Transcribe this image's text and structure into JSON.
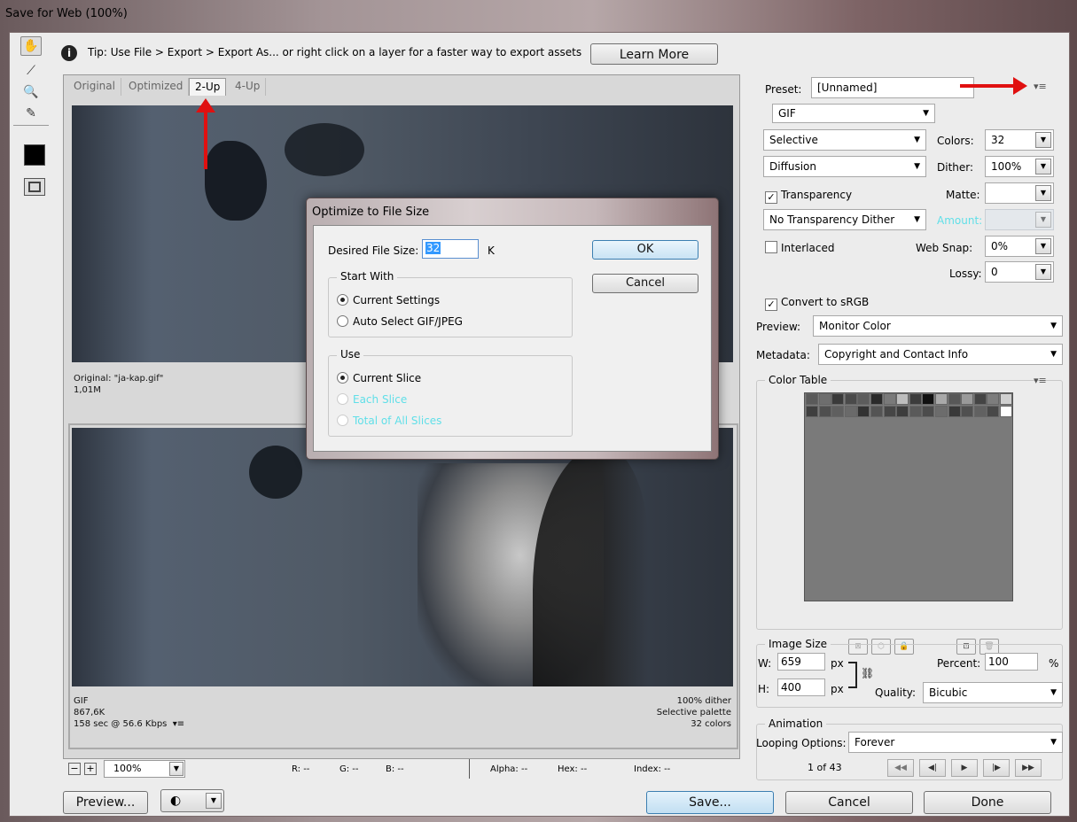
{
  "window": {
    "title": "Save for Web (100%)"
  },
  "tip": {
    "text": "Tip: Use File > Export > Export As...  or right click on a layer for a faster way to export assets",
    "learn_more": "Learn More"
  },
  "tabs": [
    "Original",
    "Optimized",
    "2-Up",
    "4-Up"
  ],
  "active_tab": "2-Up",
  "original_info": {
    "name": "Original: \"ja-kap.gif\"",
    "size": "1,01M"
  },
  "optimized_info": {
    "format": "GIF",
    "size": "867,6K",
    "time": "158 sec @ 56.6 Kbps",
    "dither": "100% dither",
    "palette": "Selective palette",
    "colors": "32 colors"
  },
  "bottom_bar": {
    "zoom": "100%",
    "r": "R: --",
    "g": "G: --",
    "b": "B: --",
    "alpha": "Alpha: --",
    "hex": "Hex: --",
    "index": "Index: --"
  },
  "buttons": {
    "preview": "Preview...",
    "save": "Save...",
    "cancel": "Cancel",
    "done": "Done"
  },
  "dialog": {
    "title": "Optimize to File Size",
    "desired_label": "Desired File Size:",
    "desired_value": "32",
    "unit": "K",
    "ok": "OK",
    "cancel": "Cancel",
    "start_with": {
      "title": "Start With",
      "options": [
        "Current Settings",
        "Auto Select GIF/JPEG"
      ],
      "selected": 0
    },
    "use": {
      "title": "Use",
      "options": [
        "Current Slice",
        "Each Slice",
        "Total of All Slices"
      ],
      "selected": 0
    }
  },
  "settings": {
    "preset_label": "Preset:",
    "preset_value": "[Unnamed]",
    "format": "GIF",
    "reduction": "Selective",
    "colors_label": "Colors:",
    "colors_value": "32",
    "dither_algo": "Diffusion",
    "dither_label": "Dither:",
    "dither_value": "100%",
    "transparency": "Transparency",
    "matte_label": "Matte:",
    "trans_dither": "No Transparency Dither",
    "amount_label": "Amount:",
    "interlaced": "Interlaced",
    "websnap_label": "Web Snap:",
    "websnap_value": "0%",
    "lossy_label": "Lossy:",
    "lossy_value": "0",
    "convert_srgb": "Convert to sRGB",
    "preview_label": "Preview:",
    "preview_value": "Monitor Color",
    "metadata_label": "Metadata:",
    "metadata_value": "Copyright and Contact Info"
  },
  "color_table": {
    "title": "Color Table",
    "count": "32"
  },
  "image_size": {
    "title": "Image Size",
    "w_label": "W:",
    "w_value": "659",
    "h_label": "H:",
    "h_value": "400",
    "px": "px",
    "percent_label": "Percent:",
    "percent_value": "100",
    "percent_unit": "%",
    "quality_label": "Quality:",
    "quality_value": "Bicubic"
  },
  "animation": {
    "title": "Animation",
    "looping_label": "Looping Options:",
    "looping_value": "Forever",
    "frame": "1 of 43"
  },
  "palette": [
    "#5a5a5a",
    "#6e6e6e",
    "#3a3a3a",
    "#4a4a4a",
    "#5c5c5c",
    "#2a2a2a",
    "#7a7a7a",
    "#bdbdbd",
    "#3c3c3c",
    "#111111",
    "#a9a9a9",
    "#585858",
    "#9a9a9a",
    "#444444",
    "#7d7d7d",
    "#d0d0d0",
    "#3f3f3f",
    "#4f4f4f",
    "#5f5f5f",
    "#6a6a6a",
    "#323232",
    "#545454",
    "#464646",
    "#3d3d3d",
    "#5a5a5a",
    "#4c4c4c",
    "#6c6c6c",
    "#393939",
    "#505050",
    "#616161",
    "#484848",
    "#ffffff"
  ],
  "annotation_color": "#e01010"
}
